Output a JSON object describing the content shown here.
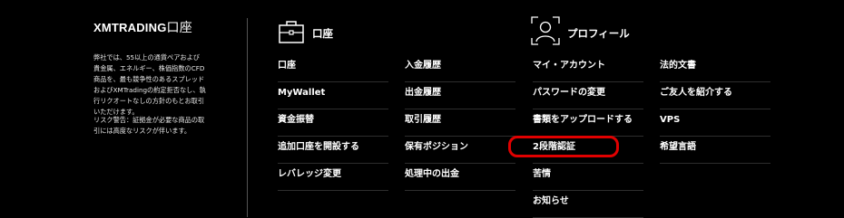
{
  "brand": {
    "name": "XMTRADING",
    "suffix": "口座"
  },
  "description": {
    "para1": [
      "弊社では、55以上の通貨ペアおよび",
      "貴金属、エネルギー、株価指数のCFD",
      "商品を、最も競争性のあるスプレッド",
      "およびXMTradingの約定拒否なし、執",
      "行リクオートなしの方針のもとお取引",
      "いただけます。"
    ],
    "para2": [
      "リスク警告：証拠金が必要な商品の取",
      "引には高度なリスクが伴います。"
    ]
  },
  "account_section": {
    "title": "口座",
    "icon": "briefcase-icon"
  },
  "profile_section": {
    "title": "プロフィール",
    "icon": "user-profile-icon"
  },
  "menus": {
    "col1": [
      "口座",
      "MyWallet",
      "資金振替",
      "追加口座を開設する",
      "レバレッジ変更"
    ],
    "col2": [
      "入金履歴",
      "出金履歴",
      "取引履歴",
      "保有ポジション",
      "処理中の出金"
    ],
    "col3": [
      "マイ・アカウント",
      "パスワードの変更",
      "書類をアップロードする",
      "2段階認証",
      "苦情",
      "お知らせ"
    ],
    "col4": [
      "法的文書",
      "ご友人を紹介する",
      "VPS",
      "希望言語"
    ]
  },
  "colors": {
    "background": "#000000",
    "highlight": "#e00000",
    "divider": "#555555"
  }
}
